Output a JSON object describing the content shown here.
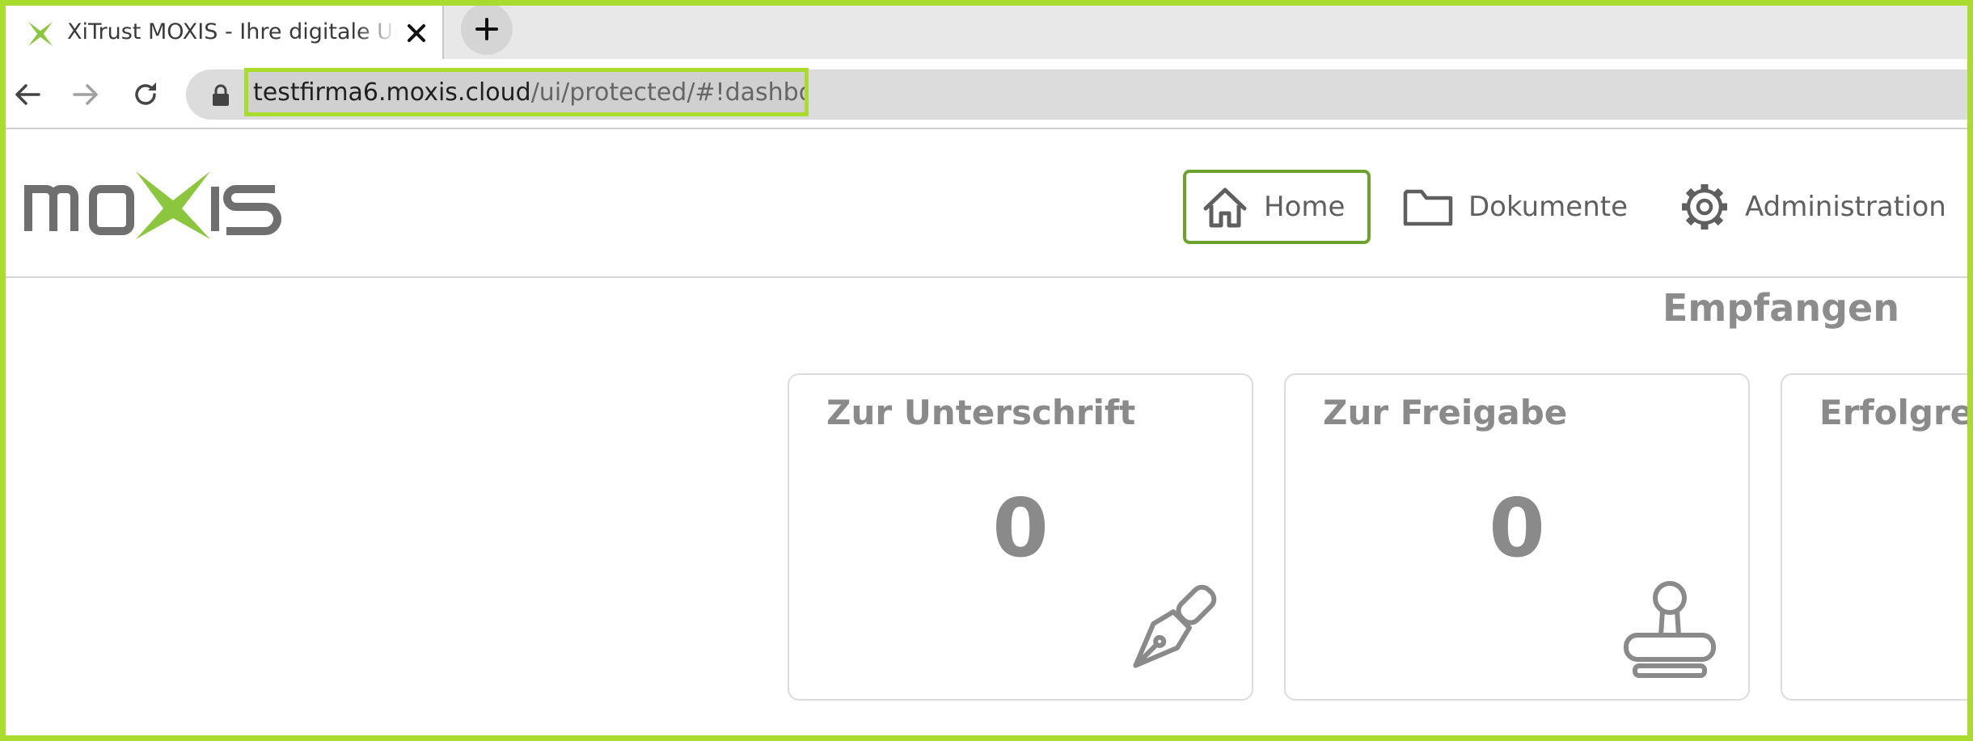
{
  "browser": {
    "tab_title": "XiTrust MOXIS - Ihre digitale Unterschrift",
    "new_tab_label": "+",
    "url_host": "testfirma6.moxis.cloud",
    "url_path": "/ui/protected/#!dashboard"
  },
  "nav": {
    "home": "Home",
    "documents": "Dokumente",
    "administration": "Administration"
  },
  "section_title": "Empfangen",
  "cards": [
    {
      "title": "Zur Unterschrift",
      "count": "0",
      "icon": "pen-nib-icon"
    },
    {
      "title": "Zur Freigabe",
      "count": "0",
      "icon": "stamp-icon"
    },
    {
      "title": "Erfolgreich",
      "count": ""
    }
  ],
  "colors": {
    "accent_green": "#a9dc2e",
    "home_border": "#6ea22e",
    "text_gray": "#8a8a8a"
  }
}
